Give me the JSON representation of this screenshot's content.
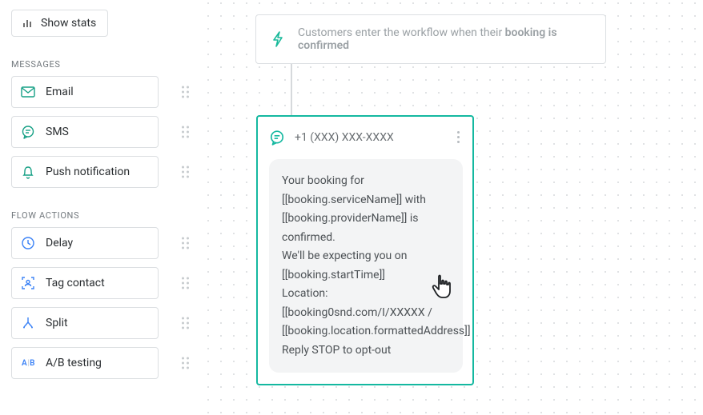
{
  "sidebar": {
    "show_stats_label": "Show stats",
    "section_messages_title": "MESSAGES",
    "section_flow_actions_title": "FLOW ACTIONS",
    "message_blocks": [
      {
        "label": "Email"
      },
      {
        "label": "SMS"
      },
      {
        "label": "Push notification"
      }
    ],
    "flow_action_blocks": [
      {
        "label": "Delay"
      },
      {
        "label": "Tag contact"
      },
      {
        "label": "Split"
      },
      {
        "label": "A/B testing"
      }
    ]
  },
  "trigger": {
    "prefix": "Customers enter the workflow when their ",
    "emphasis": "booking is confirmed"
  },
  "sms_node": {
    "from_number": "+1 (XXX) XXX-XXXX",
    "body": "Your booking for [[booking.serviceName]] with [[booking.providerName]] is confirmed.\nWe'll be expecting you on [[booking.startTime]]\nLocation: [[booking0snd.com/I/XXXXX / [[booking.location.formattedAddress]]\nReply STOP to opt-out"
  }
}
